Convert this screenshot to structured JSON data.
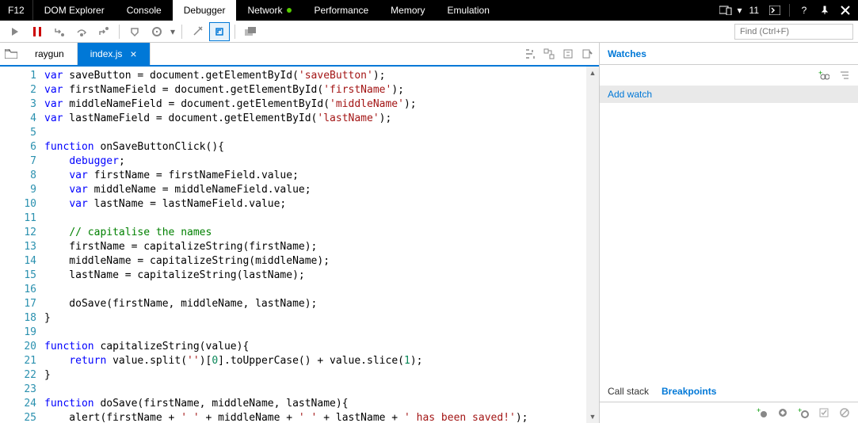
{
  "titlebar": {
    "f12": "F12",
    "tabs": [
      "DOM Explorer",
      "Console",
      "Debugger",
      "Network",
      "Performance",
      "Memory",
      "Emulation"
    ],
    "active_tab": 2,
    "error_count": "11"
  },
  "toolbar": {
    "find_placeholder": "Find (Ctrl+F)"
  },
  "filetabs": {
    "folder_label": "raygun",
    "file_label": "index.js"
  },
  "code_lines": [
    [
      {
        "t": "kw",
        "v": "var"
      },
      {
        "t": "",
        "v": " saveButton = document.getElementById("
      },
      {
        "t": "str",
        "v": "'saveButton'"
      },
      {
        "t": "",
        "v": ");"
      }
    ],
    [
      {
        "t": "kw",
        "v": "var"
      },
      {
        "t": "",
        "v": " firstNameField = document.getElementById("
      },
      {
        "t": "str",
        "v": "'firstName'"
      },
      {
        "t": "",
        "v": ");"
      }
    ],
    [
      {
        "t": "kw",
        "v": "var"
      },
      {
        "t": "",
        "v": " middleNameField = document.getElementById("
      },
      {
        "t": "str",
        "v": "'middleName'"
      },
      {
        "t": "",
        "v": ");"
      }
    ],
    [
      {
        "t": "kw",
        "v": "var"
      },
      {
        "t": "",
        "v": " lastNameField = document.getElementById("
      },
      {
        "t": "str",
        "v": "'lastName'"
      },
      {
        "t": "",
        "v": ");"
      }
    ],
    [],
    [
      {
        "t": "kw",
        "v": "function"
      },
      {
        "t": "",
        "v": " onSaveButtonClick(){"
      }
    ],
    [
      {
        "t": "",
        "v": "    "
      },
      {
        "t": "kw",
        "v": "debugger"
      },
      {
        "t": "",
        "v": ";"
      }
    ],
    [
      {
        "t": "",
        "v": "    "
      },
      {
        "t": "kw",
        "v": "var"
      },
      {
        "t": "",
        "v": " firstName = firstNameField.value;"
      }
    ],
    [
      {
        "t": "",
        "v": "    "
      },
      {
        "t": "kw",
        "v": "var"
      },
      {
        "t": "",
        "v": " middleName = middleNameField.value;"
      }
    ],
    [
      {
        "t": "",
        "v": "    "
      },
      {
        "t": "kw",
        "v": "var"
      },
      {
        "t": "",
        "v": " lastName = lastNameField.value;"
      }
    ],
    [],
    [
      {
        "t": "",
        "v": "    "
      },
      {
        "t": "com",
        "v": "// capitalise the names"
      }
    ],
    [
      {
        "t": "",
        "v": "    firstName = capitalizeString(firstName);"
      }
    ],
    [
      {
        "t": "",
        "v": "    middleName = capitalizeString(middleName);"
      }
    ],
    [
      {
        "t": "",
        "v": "    lastName = capitalizeString(lastName);"
      }
    ],
    [],
    [
      {
        "t": "",
        "v": "    doSave(firstName, middleName, lastName);"
      }
    ],
    [
      {
        "t": "",
        "v": "}"
      }
    ],
    [],
    [
      {
        "t": "kw",
        "v": "function"
      },
      {
        "t": "",
        "v": " capitalizeString(value){"
      }
    ],
    [
      {
        "t": "",
        "v": "    "
      },
      {
        "t": "kw",
        "v": "return"
      },
      {
        "t": "",
        "v": " value.split("
      },
      {
        "t": "str",
        "v": "''"
      },
      {
        "t": "",
        "v": ")["
      },
      {
        "t": "num",
        "v": "0"
      },
      {
        "t": "",
        "v": "].toUpperCase() + value.slice("
      },
      {
        "t": "num",
        "v": "1"
      },
      {
        "t": "",
        "v": ");"
      }
    ],
    [
      {
        "t": "",
        "v": "}"
      }
    ],
    [],
    [
      {
        "t": "kw",
        "v": "function"
      },
      {
        "t": "",
        "v": " doSave(firstName, middleName, lastName){"
      }
    ],
    [
      {
        "t": "",
        "v": "    alert(firstName + "
      },
      {
        "t": "str",
        "v": "' '"
      },
      {
        "t": "",
        "v": " + middleName + "
      },
      {
        "t": "str",
        "v": "' '"
      },
      {
        "t": "",
        "v": " + lastName + "
      },
      {
        "t": "str",
        "v": "' has been saved!'"
      },
      {
        "t": "",
        "v": ");"
      }
    ]
  ],
  "watches": {
    "header": "Watches",
    "add": "Add watch"
  },
  "callstack": {
    "tab1": "Call stack",
    "tab2": "Breakpoints"
  }
}
